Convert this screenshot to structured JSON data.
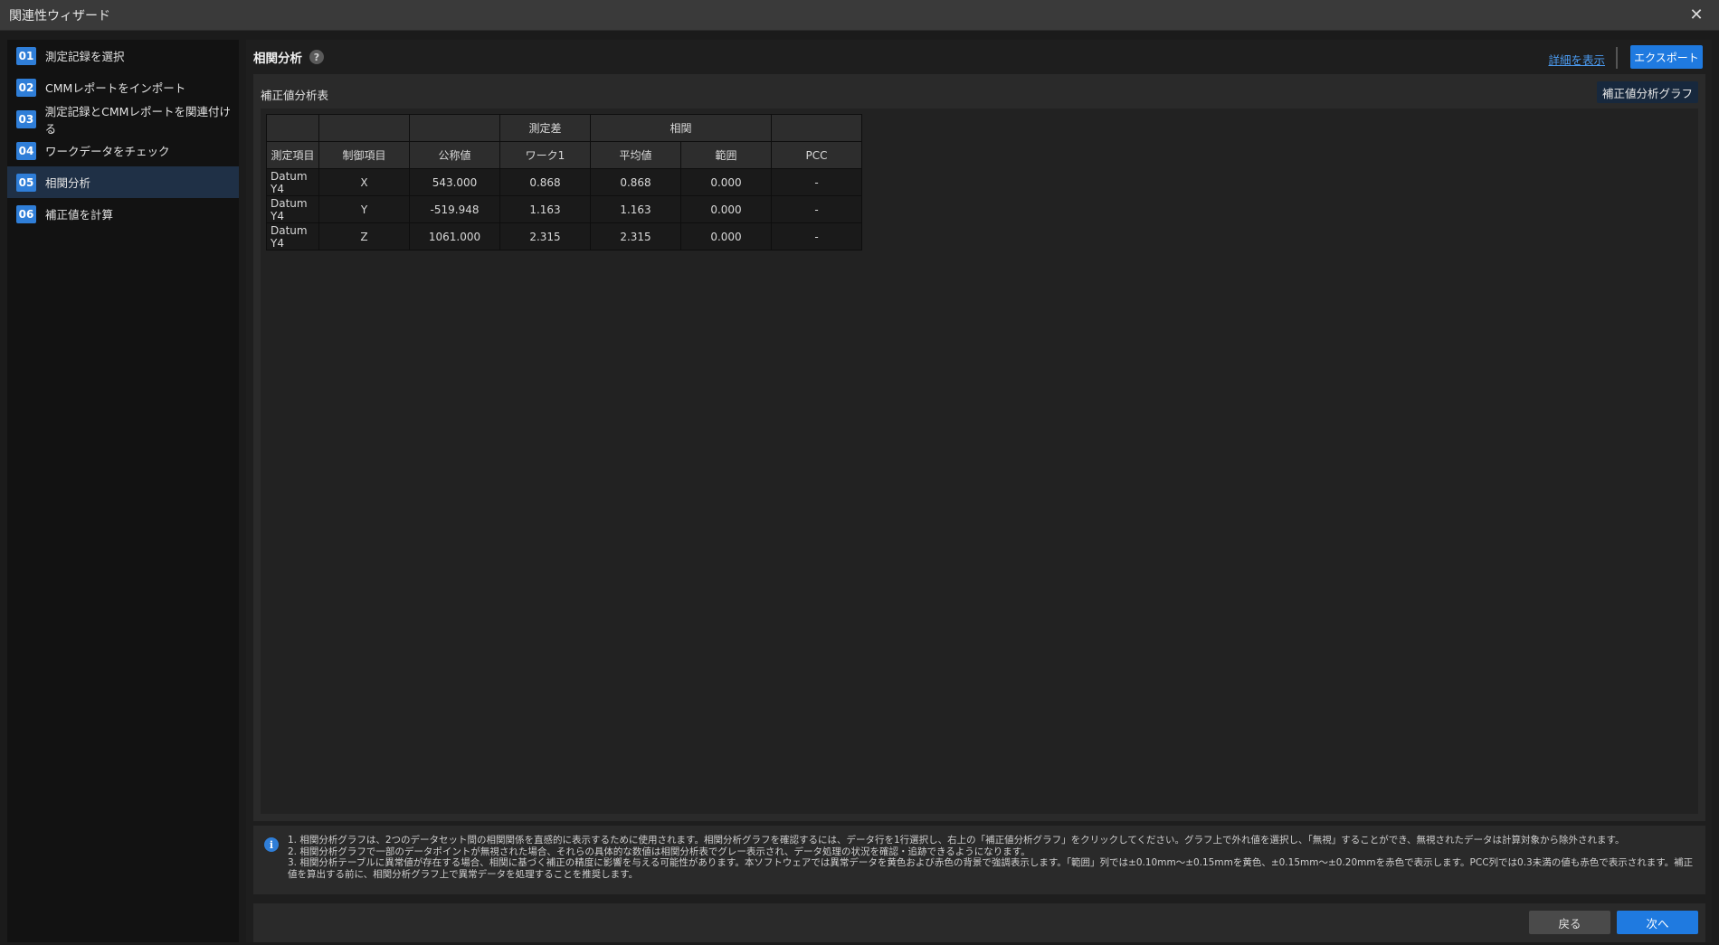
{
  "window": {
    "title": "関連性ウィザード"
  },
  "steps": [
    {
      "num": "01",
      "label": "測定記録を選択"
    },
    {
      "num": "02",
      "label": "CMMレポートをインポート"
    },
    {
      "num": "03",
      "label": "測定記録とCMMレポートを関連付ける"
    },
    {
      "num": "04",
      "label": "ワークデータをチェック"
    },
    {
      "num": "05",
      "label": "相関分析"
    },
    {
      "num": "06",
      "label": "補正値を計算"
    }
  ],
  "active_step": "05",
  "header": {
    "title": "相関分析",
    "help": "?",
    "detail_link": "詳細を表示",
    "export_label": "エクスポート"
  },
  "card": {
    "title": "補正値分析表",
    "graph_button": "補正値分析グラフ"
  },
  "table": {
    "group_headers": {
      "measurement_diff": "測定差",
      "correlation": "相関"
    },
    "columns": [
      "測定項目",
      "制御項目",
      "公称値",
      "ワーク1",
      "平均値",
      "範囲",
      "PCC"
    ],
    "rows": [
      [
        "Datum Y4",
        "X",
        "543.000",
        "0.868",
        "0.868",
        "0.000",
        "-"
      ],
      [
        "Datum Y4",
        "Y",
        "-519.948",
        "1.163",
        "1.163",
        "0.000",
        "-"
      ],
      [
        "Datum Y4",
        "Z",
        "1061.000",
        "2.315",
        "2.315",
        "0.000",
        "-"
      ]
    ]
  },
  "info": {
    "icon": "i",
    "lines": [
      "1. 相関分析グラフは、2つのデータセット間の相関関係を直感的に表示するために使用されます。相関分析グラフを確認するには、データ行を1行選択し、右上の「補正値分析グラフ」をクリックしてください。グラフ上で外れ値を選択し、「無視」することができ、無視されたデータは計算対象から除外されます。",
      "2. 相関分析グラフで一部のデータポイントが無視された場合、それらの具体的な数値は相関分析表でグレー表示され、データ処理の状況を確認・追跡できるようになります。",
      "3. 相関分析テーブルに異常値が存在する場合、相関に基づく補正の精度に影響を与える可能性があります。本ソフトウェアでは異常データを黄色および赤色の背景で強調表示します。「範囲」列では±0.10mm～±0.15mmを黄色、±0.15mm～±0.20mmを赤色で表示します。PCC列では0.3未満の値も赤色で表示されます。補正",
      "値を算出する前に、相関分析グラフ上で異常データを処理することを推奨します。"
    ]
  },
  "footer": {
    "back_label": "戻る",
    "next_label": "次へ"
  },
  "colors": {
    "accent": "#1f7ae0",
    "active_step_bg": "#1f3046"
  }
}
